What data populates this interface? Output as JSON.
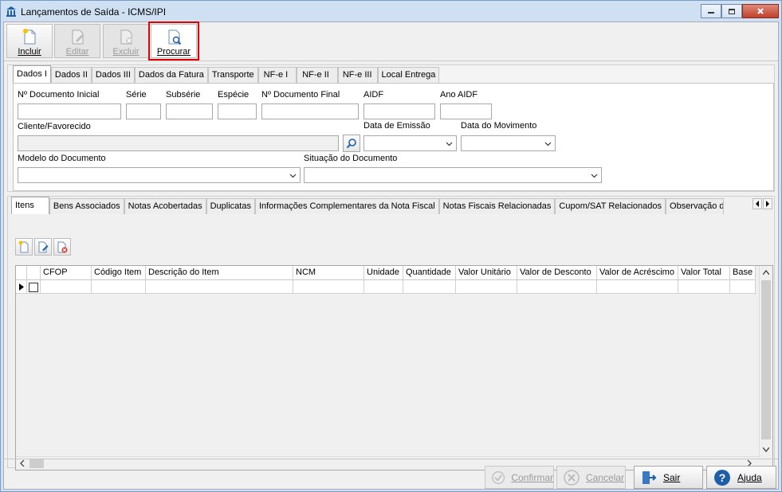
{
  "window": {
    "title": "Lançamentos de Saída - ICMS/IPI"
  },
  "toolbar": {
    "incluir": "Incluir",
    "editar": "Editar",
    "excluir": "Excluir",
    "procurar": "Procurar"
  },
  "upper_tabs": [
    "Dados I",
    "Dados II",
    "Dados III",
    "Dados da Fatura",
    "Transporte",
    "NF-e I",
    "NF-e II",
    "NF-e III",
    "Local Entrega"
  ],
  "form": {
    "numero_documento_inicial": "Nº Documento Inicial",
    "serie": "Série",
    "subserie": "Subsérie",
    "especie": "Espécie",
    "numero_documento_final": "Nº Documento Final",
    "aidf": "AIDF",
    "ano_aidf": "Ano AIDF",
    "cliente_favorecido": "Cliente/Favorecido",
    "data_emissao": "Data de Emissão",
    "data_movimento": "Data do Movimento",
    "modelo_documento": "Modelo do Documento",
    "situacao_documento": "Situação do Documento"
  },
  "lower_tabs": [
    "Itens",
    "Bens Associados",
    "Notas Acobertadas",
    "Duplicatas",
    "Informações Complementares da Nota Fiscal",
    "Notas Fiscais Relacionadas",
    "Cupom/SAT Relacionados",
    "Observação d"
  ],
  "grid": {
    "columns": [
      "CFOP",
      "Código Item",
      "Descrição do Item",
      "NCM",
      "Unidade",
      "Quantidade",
      "Valor Unitário",
      "Valor de Desconto",
      "Valor de Acréscimo",
      "Valor Total",
      "Base c"
    ]
  },
  "footer": {
    "confirmar": "Confirmar",
    "cancelar": "Cancelar",
    "sair": "Sair",
    "ajuda": "Ajuda"
  },
  "colors": {
    "highlight": "#e00000",
    "titlebar": "#cfe0f3",
    "accent": "#1f5fa8"
  }
}
